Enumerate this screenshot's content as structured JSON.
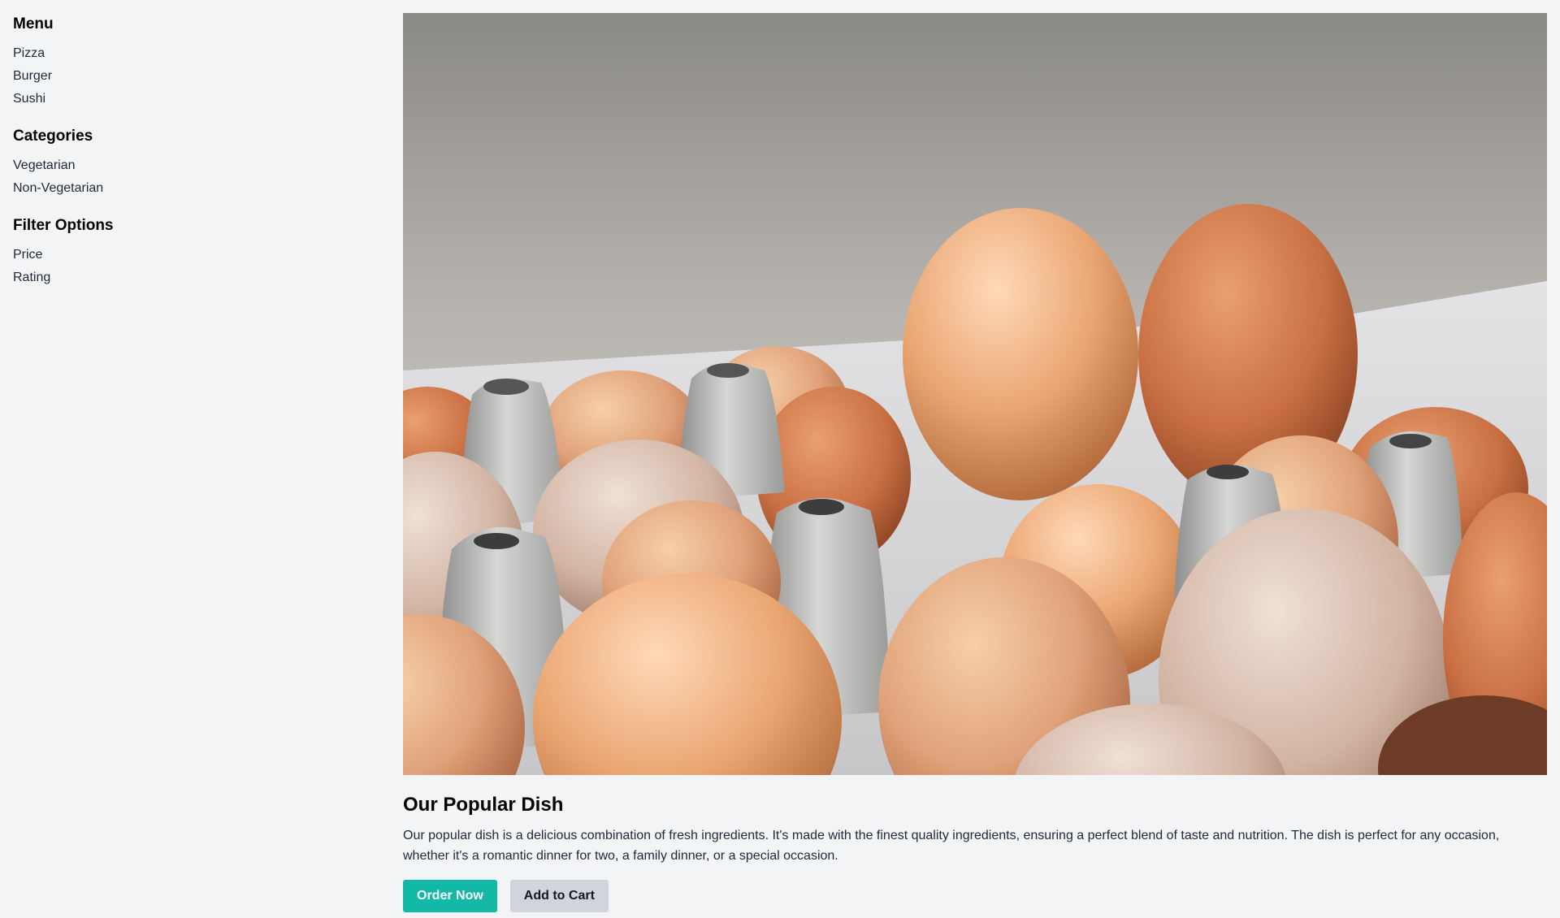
{
  "sidebar": {
    "sections": [
      {
        "title": "Menu",
        "items": [
          "Pizza",
          "Burger",
          "Sushi"
        ]
      },
      {
        "title": "Categories",
        "items": [
          "Vegetarian",
          "Non-Vegetarian"
        ]
      },
      {
        "title": "Filter Options",
        "items": [
          "Price",
          "Rating"
        ]
      }
    ]
  },
  "main": {
    "image_subject": "brown eggs in a carton",
    "title": "Our Popular Dish",
    "description": "Our popular dish is a delicious combination of fresh ingredients. It's made with the finest quality ingredients, ensuring a perfect blend of taste and nutrition. The dish is perfect for any occasion, whether it's a romantic dinner for two, a family dinner, or a special occasion.",
    "buttons": {
      "order": "Order Now",
      "cart": "Add to Cart"
    }
  },
  "colors": {
    "background": "#f3f4f6",
    "primary_button": "#14b8a6",
    "secondary_button": "#d1d5db"
  }
}
